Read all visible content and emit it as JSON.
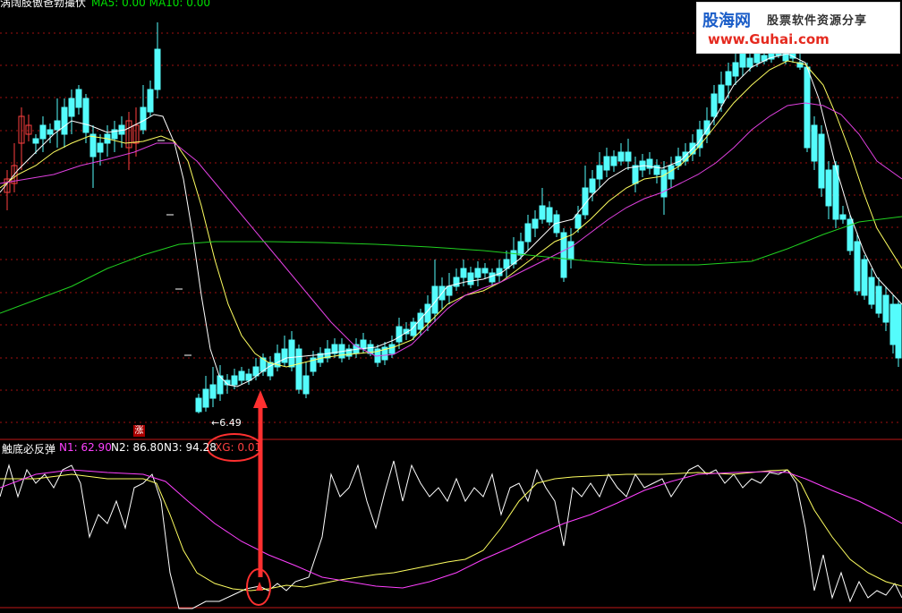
{
  "header": {
    "title": "涡阔肢傲爸勃撮伏",
    "ma_text": "MA5: 0.00  MA10: 0.00"
  },
  "logo": {
    "brand": "股海网",
    "tagline": "股票软件资源分享",
    "url": "www.Guhai.com"
  },
  "price_panel": {
    "low_marker": "←6.49",
    "zhang_badge": "涨"
  },
  "indicator": {
    "name": "触底必反弹",
    "n1_label": "N1: 62.90",
    "n2_label": "N2: 86.80",
    "n3_label": "N3: 94.28",
    "xg_label": "XG: 0.01"
  },
  "colors": {
    "bull": "#ff4040",
    "bear": "#54fcfc",
    "n1": "#ff40ff",
    "n2": "#ffffff",
    "n3": "#ffffff",
    "xg": "#ff4040",
    "ma_white": "#ffffff",
    "ma_yellow": "#ffff60",
    "ma_magenta": "#e040e0",
    "ma_green": "#20d020",
    "annotation": "#ff3030"
  }
}
